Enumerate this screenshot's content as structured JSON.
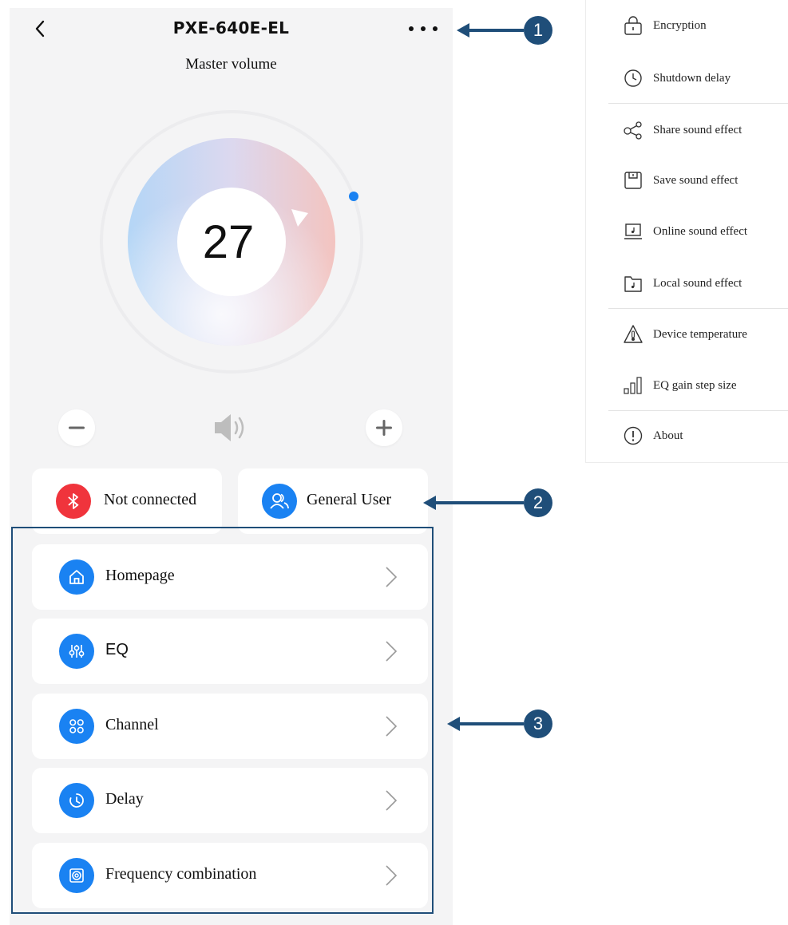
{
  "header": {
    "title": "PXE-640E-EL",
    "subtitle": "Master volume"
  },
  "volume": {
    "value": "27",
    "level_fraction": 0.27
  },
  "status": {
    "connection_label": "Not connected",
    "user_label": "General User"
  },
  "menu": [
    {
      "label": "Homepage",
      "icon": "home-icon"
    },
    {
      "label": "EQ",
      "icon": "eq-sliders-icon"
    },
    {
      "label": "Channel",
      "icon": "channel-grid-icon"
    },
    {
      "label": "Delay",
      "icon": "clock-icon"
    },
    {
      "label": "Frequency combination",
      "icon": "speaker-box-icon"
    }
  ],
  "popup": [
    {
      "label": "Encryption",
      "icon": "lock-icon"
    },
    {
      "label": "Shutdown delay",
      "icon": "clock-icon"
    },
    {
      "label": "Share sound effect",
      "icon": "share-icon"
    },
    {
      "label": "Save sound effect",
      "icon": "save-icon"
    },
    {
      "label": "Online sound effect",
      "icon": "laptop-music-icon"
    },
    {
      "label": "Local sound effect",
      "icon": "folder-music-icon"
    },
    {
      "label": "Device temperature",
      "icon": "thermometer-icon"
    },
    {
      "label": "EQ gain step size",
      "icon": "signal-bars-icon"
    },
    {
      "label": "About",
      "icon": "info-icon"
    }
  ],
  "markers": [
    "1",
    "2",
    "3"
  ],
  "colors": {
    "accent_blue": "#1a82f2",
    "bluetooth_red": "#f0343c",
    "annotation_navy": "#1f4e79",
    "panel_bg": "#f4f4f5"
  }
}
